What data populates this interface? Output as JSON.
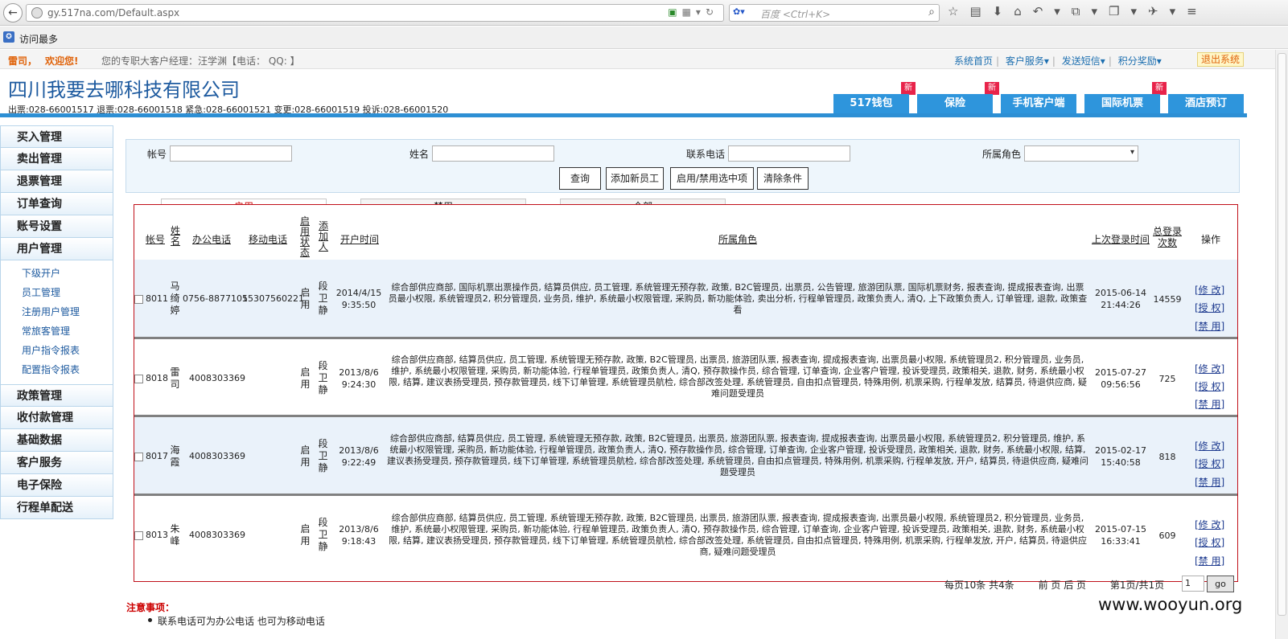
{
  "browser": {
    "url": "gy.517na.com/Default.aspx",
    "search_placeholder": "百度 <Ctrl+K>",
    "bookmark": "访问最多"
  },
  "topbar": {
    "greet": "雷司，",
    "welcome": "欢迎您!",
    "manager": "您的专职大客户经理：汪学渊【电话：  QQ: 】",
    "links": [
      "系统首页",
      "客户服务▾",
      "发送短信▾",
      "积分奖励▾"
    ],
    "logout": "退出系统"
  },
  "header": {
    "company": "四川我要去哪科技有限公司",
    "hotlines": "出票:028-66001517 退票:028-66001518 紧急:028-66001521 变更:028-66001519 投诉:028-66001520",
    "tabs": [
      "517钱包",
      "保险",
      "手机客户端",
      "国际机票",
      "酒店预订"
    ],
    "new_badge": "新"
  },
  "sidebar": {
    "top": [
      "买入管理",
      "卖出管理",
      "退票管理",
      "订单查询",
      "账号设置",
      "用户管理"
    ],
    "sub": [
      "下级开户",
      "员工管理",
      "注册用户管理",
      "常旅客管理",
      "用户指令报表",
      "配置指令报表"
    ],
    "bottom": [
      "政策管理",
      "收付款管理",
      "基础数据",
      "客户服务",
      "电子保险",
      "行程单配送"
    ]
  },
  "filter": {
    "account_label": "帐号",
    "name_label": "姓名",
    "phone_label": "联系电话",
    "role_label": "所属角色",
    "buttons": [
      "查询",
      "添加新员工",
      "启用/禁用选中项",
      "清除条件"
    ]
  },
  "tabs": [
    "启用",
    "禁用",
    "全部"
  ],
  "table": {
    "headers": {
      "account": "帐号",
      "name": "姓名",
      "office": "办公电话",
      "mobile": "移动电话",
      "status": "启用状态",
      "adder": "添加人",
      "created": "开户时间",
      "roles": "所属角色",
      "last_login": "上次登录时间",
      "total_login": "总登录次数",
      "ops": "操作"
    },
    "rows": [
      {
        "account": "8011",
        "name": "马绮婷",
        "office": "0756-8877105",
        "mobile": "15307560221",
        "status": "启用",
        "adder": "段卫静",
        "date": "2014/4/15",
        "time": "9:35:50",
        "roles": "综合部供应商部, 国际机票出票操作员, 结算员供应, 员工管理, 系统管理无预存款, 政策, B2C管理员, 出票员, 公告管理, 旅游团队票, 国际机票财务, 报表查询, 提成报表查询, 出票员最小权限, 系统管理员2, 积分管理员, 业务员, 维护, 系统最小权限管理, 采购员, 新功能体验, 卖出分析, 行程单管理员, 政策负责人, 清Q, 上下政策负责人, 订单管理, 退款, 政策查看",
        "last_date": "2015-06-14",
        "last_time": "21:44:26",
        "count": "14559"
      },
      {
        "account": "8018",
        "name": "雷司",
        "office": "4008303369",
        "mobile": "",
        "status": "启用",
        "adder": "段卫静",
        "date": "2013/8/6",
        "time": "9:24:30",
        "roles": "综合部供应商部, 结算员供应, 员工管理, 系统管理无预存款, 政策, B2C管理员, 出票员, 旅游团队票, 报表查询, 提成报表查询, 出票员最小权限, 系统管理员2, 积分管理员, 业务员, 维护, 系统最小权限管理, 采购员, 新功能体验, 行程单管理员, 政策负责人, 清Q, 预存款操作员, 综合管理, 订单查询, 企业客户管理, 投诉受理员, 政策相关, 退款, 财务, 系统最小权限, 结算, 建议表扬受理员, 预存款管理员, 线下订单管理, 系统管理员航检, 综合部改签处理, 系统管理员, 自由扣点管理员, 特殊用例, 机票采购, 行程单发放, 结算员, 待退供应商, 疑难问题受理员",
        "last_date": "2015-07-27",
        "last_time": "09:56:56",
        "count": "725"
      },
      {
        "account": "8017",
        "name": "海霞",
        "office": "4008303369",
        "mobile": "",
        "status": "启用",
        "adder": "段卫静",
        "date": "2013/8/6",
        "time": "9:22:49",
        "roles": "综合部供应商部, 结算员供应, 员工管理, 系统管理无预存款, 政策, B2C管理员, 出票员, 旅游团队票, 报表查询, 提成报表查询, 出票员最小权限, 系统管理员2, 积分管理员, 维护, 系统最小权限管理, 采购员, 新功能体验, 行程单管理员, 政策负责人, 清Q, 预存款操作员, 综合管理, 订单查询, 企业客户管理, 投诉受理员, 政策相关, 退款, 财务, 系统最小权限, 结算, 建议表扬受理员, 预存款管理员, 线下订单管理, 系统管理员航检, 综合部改签处理, 系统管理员, 自由扣点管理员, 特殊用例, 机票采购, 行程单发放, 开户, 结算员, 待退供应商, 疑难问题受理员",
        "last_date": "2015-02-17",
        "last_time": "15:40:58",
        "count": "818"
      },
      {
        "account": "8013",
        "name": "朱峰",
        "office": "4008303369",
        "mobile": "",
        "status": "启用",
        "adder": "段卫静",
        "date": "2013/8/6",
        "time": "9:18:43",
        "roles": "综合部供应商部, 结算员供应, 员工管理, 系统管理无预存款, 政策, B2C管理员, 出票员, 旅游团队票, 报表查询, 提成报表查询, 出票员最小权限, 系统管理员2, 积分管理员, 业务员, 维护, 系统最小权限管理, 采购员, 新功能体验, 行程单管理员, 政策负责人, 清Q, 预存款操作员, 综合管理, 订单查询, 企业客户管理, 投诉受理员, 政策相关, 退款, 财务, 系统最小权限, 结算, 建议表扬受理员, 预存款管理员, 线下订单管理, 系统管理员航检, 综合部改签处理, 系统管理员, 自由扣点管理员, 特殊用例, 机票采购, 行程单发放, 开户, 结算员, 待退供应商, 疑难问题受理员",
        "last_date": "2015-07-15",
        "last_time": "16:33:41",
        "count": "609"
      }
    ],
    "actions": [
      "[修 改]",
      "[授 权]",
      "[禁 用]"
    ]
  },
  "pager": {
    "summary": "每页10条 共4条",
    "nav": "前 页 后 页",
    "page": "第1页/共1页",
    "input": "1",
    "go": "go"
  },
  "notes": {
    "title": "注意事项：",
    "item": "联系电话可为办公电话 也可为移动电话"
  },
  "watermark": "www.wooyun.org"
}
